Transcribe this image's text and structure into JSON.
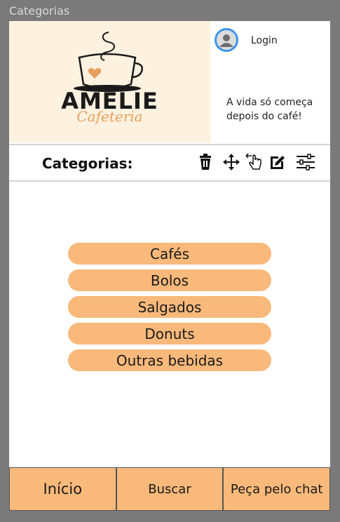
{
  "window": {
    "title": "Categorias"
  },
  "header": {
    "brand": "AMELIE",
    "brand_sub": "Cafeteria",
    "login_label": "Login",
    "tagline": "A vida só começa depois do café!"
  },
  "toolbar": {
    "title": "Categorias:",
    "icons": [
      "trash-icon",
      "move-icon",
      "tap-hand-icon",
      "edit-icon",
      "sliders-icon"
    ]
  },
  "categories": [
    "Cafés",
    "Bolos",
    "Salgados",
    "Donuts",
    "Outras bebidas"
  ],
  "nav": {
    "home": "Início",
    "search": "Buscar",
    "chat": "Peça pelo chat"
  },
  "colors": {
    "accent": "#f8b97a",
    "banner_bg": "#fdf1df",
    "avatar_ring": "#3a95e8",
    "brand_sub": "#e8a05c"
  }
}
